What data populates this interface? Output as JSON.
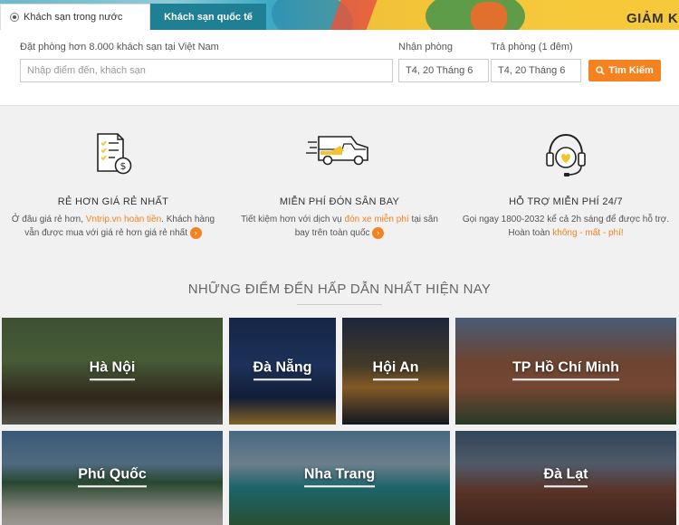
{
  "hero": {
    "promo_text": "GIẢM K"
  },
  "tabs": {
    "domestic": "Khách sạn trong nước",
    "international": "Khách sạn quốc tế"
  },
  "search": {
    "destination_label": "Đặt phòng hơn 8.000 khách sạn tại Việt Nam",
    "destination_placeholder": "Nhập điểm đến, khách sạn",
    "checkin_label": "Nhận phòng",
    "checkin_value": "T4, 20 Tháng 6",
    "checkout_label": "Trả phòng (1 đêm)",
    "checkout_value": "T4, 20 Tháng 6",
    "button_label": "Tìm Kiếm"
  },
  "features": [
    {
      "title": "RẺ HƠN GIÁ RẺ NHẤT",
      "text_before": "Ở đâu giá rẻ hơn, ",
      "highlight": "Vntrip.vn hoàn tiền",
      "text_after": ". Khách hàng vẫn được mua với giá rẻ hơn giá rẻ nhất"
    },
    {
      "title": "MIỄN PHÍ ĐÓN SÂN BAY",
      "text_before": "Tiết kiệm hơn với dịch vụ ",
      "highlight": "đón xe miễn phí",
      "text_after": " tại sân bay trên toàn quốc"
    },
    {
      "title": "HỖ TRỢ MIỄN PHÍ 24/7",
      "text_before": "Gọi ngay 1800-2032 kể cả 2h sáng để được hỗ trợ. Hoàn toàn ",
      "highlight": "không - mất - phí!",
      "text_after": ""
    }
  ],
  "section_title": "NHỮNG ĐIỂM ĐẾN HẤP DẪN NHẤT HIỆN NAY",
  "destinations": [
    "Hà Nội",
    "Đà Nẵng",
    "Hội An",
    "TP Hồ Chí Minh",
    "Phú Quốc",
    "Nha Trang",
    "Đà Lạt"
  ],
  "icons": {
    "search": "search-icon",
    "feature_1": "invoice-dollar-icon",
    "feature_2": "van-icon",
    "feature_3": "headset-heart-icon"
  },
  "colors": {
    "accent": "#f5821f",
    "tab_active": "#1f7f95",
    "icon_yellow": "#f6c22e"
  }
}
